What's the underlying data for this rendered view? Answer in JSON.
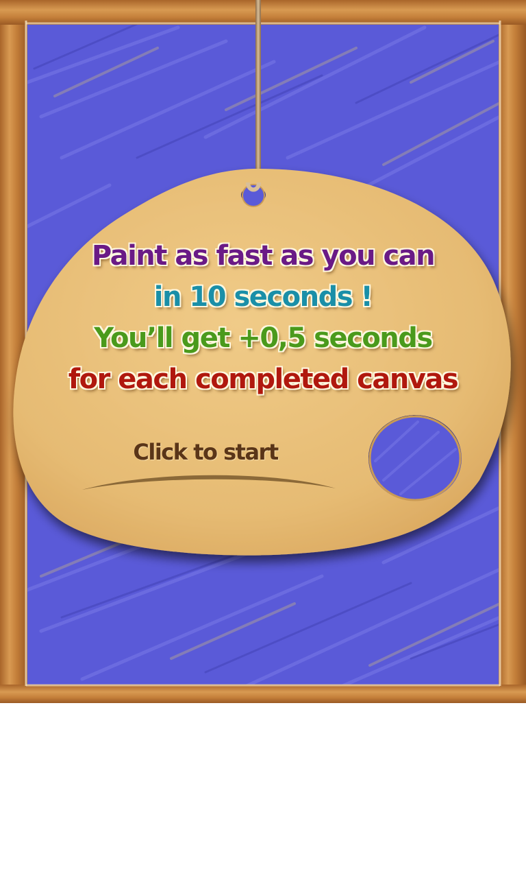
{
  "instructions": {
    "line1": "Paint as fast as you can",
    "line2": "in 10 seconds !",
    "line3": "You’ll get +0,5 seconds",
    "line4": "for each completed canvas"
  },
  "start_button": {
    "label": "Click to start"
  },
  "colors": {
    "canvas_blue": "#5a5ad8",
    "frame_wood": "#c8853a",
    "palette_tan": "#e8bf78",
    "line1": "#6a1a86",
    "line2": "#1a8fa8",
    "line3": "#4a9a1c",
    "line4": "#b0180e",
    "start_text": "#5a3518"
  }
}
